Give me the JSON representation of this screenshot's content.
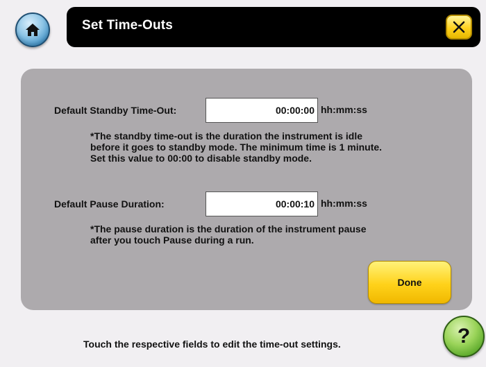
{
  "header": {
    "title": "Set Time-Outs",
    "home_icon": "home-icon",
    "close_icon": "close-icon"
  },
  "settings": {
    "standby": {
      "label": "Default Standby Time-Out:",
      "value": "00:00:00",
      "unit": "hh:mm:ss",
      "note_lines": [
        "*The standby time-out is the duration the instrument is idle",
        "before it goes to standby mode. The minimum time is 1 minute.",
        "Set this value to 00:00 to disable standby mode."
      ]
    },
    "pause": {
      "label": "Default Pause Duration:",
      "value": "00:00:10",
      "unit": "hh:mm:ss",
      "note_lines": [
        "*The pause duration is the duration of the instrument pause",
        "after you touch Pause during a run."
      ]
    },
    "done_label": "Done"
  },
  "footer": {
    "instruction": "Touch the respective fields to edit the time-out settings.",
    "help_label": "?"
  },
  "colors": {
    "background": "#f1eff2",
    "panel": "#adaaad",
    "title_bar": "#000000",
    "accent_yellow": "#ffd21f",
    "home_blue": "#3f8fc4",
    "help_green": "#9bd45a"
  }
}
